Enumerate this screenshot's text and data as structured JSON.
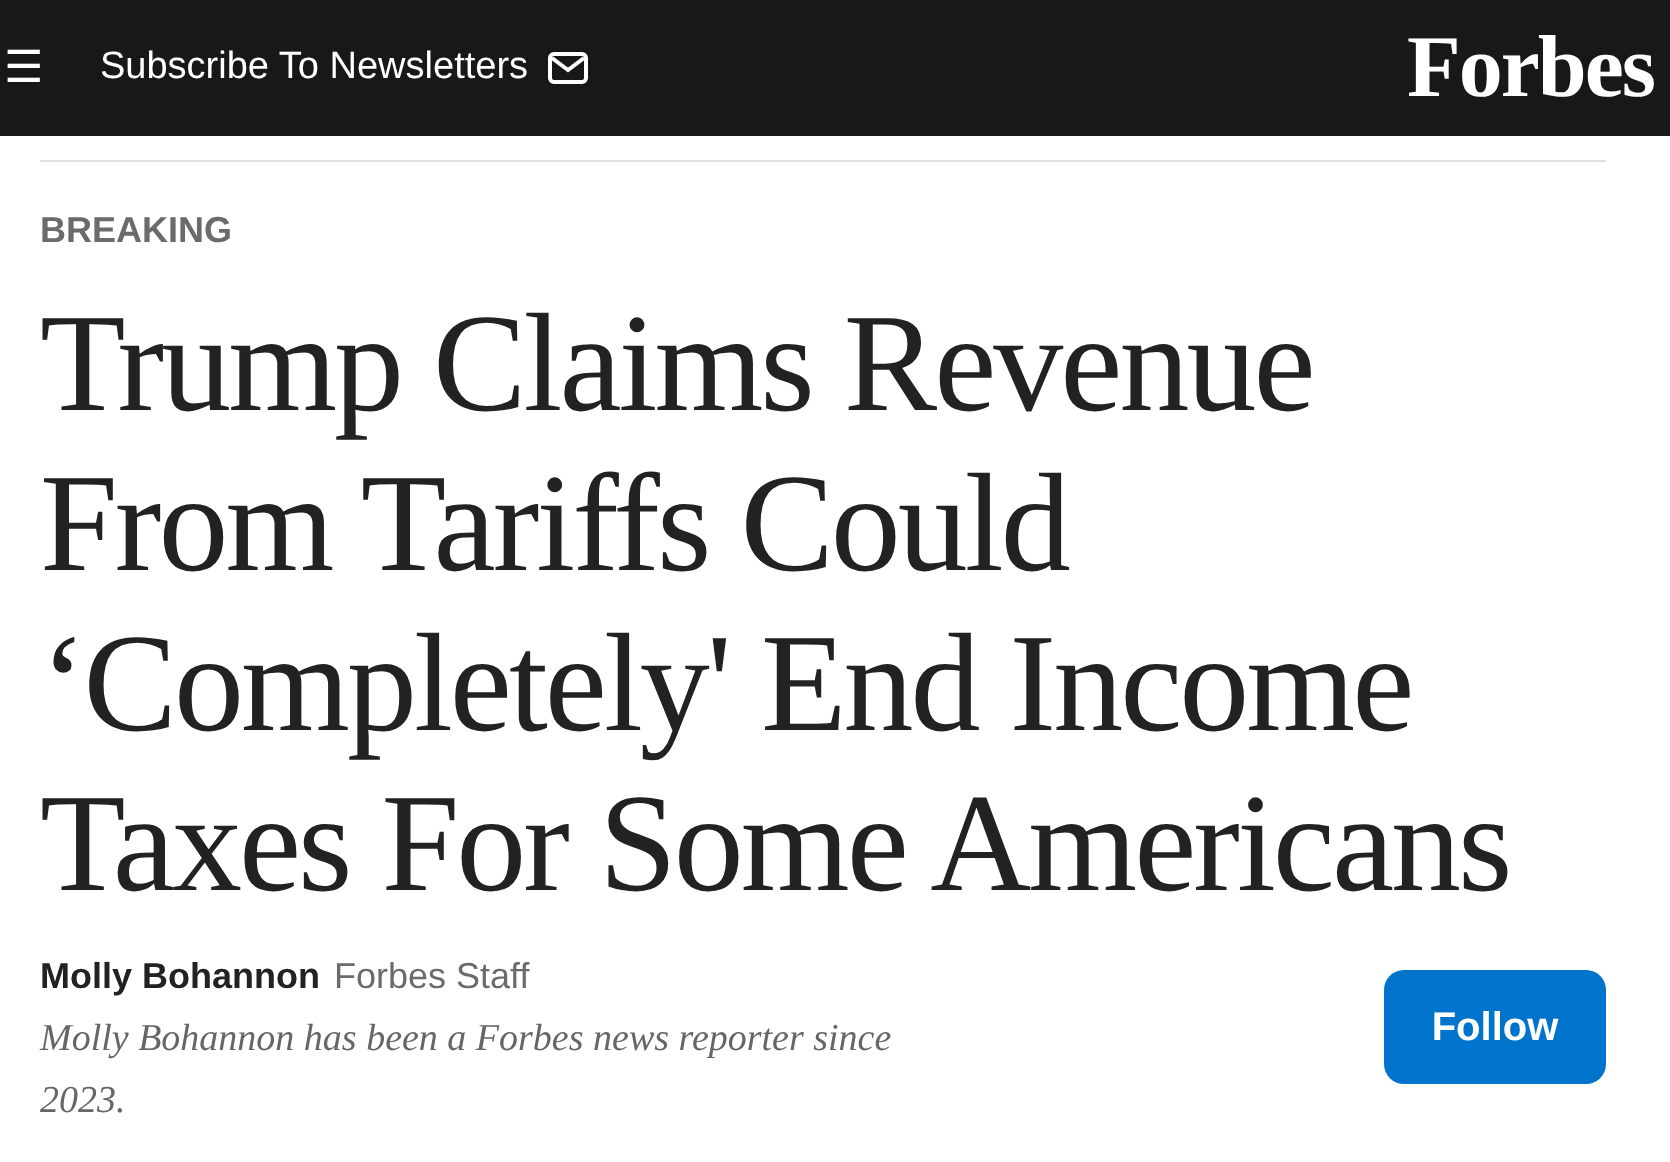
{
  "header": {
    "menu_glyph": "☰",
    "subscribe_label": "Subscribe To Newsletters",
    "logo": "Forbes"
  },
  "article": {
    "label": "BREAKING",
    "headline": "Trump Claims Revenue From Tariffs Could ‘Completely' End Income Taxes For Some Americans"
  },
  "author": {
    "name": "Molly Bohannon",
    "role": "Forbes Staff",
    "bio": "Molly Bohannon has been a Forbes news reporter since 2023.",
    "follow_label": "Follow"
  }
}
